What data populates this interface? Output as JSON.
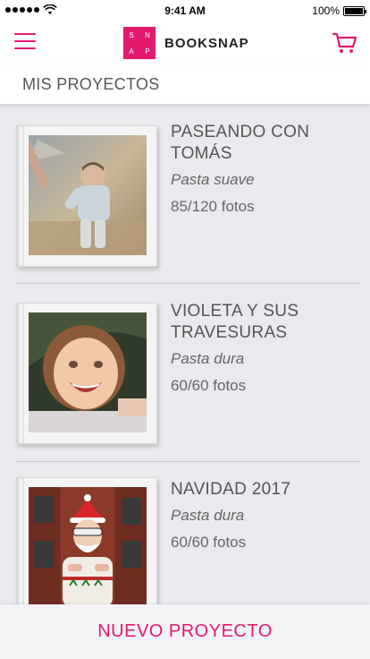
{
  "status_bar": {
    "carrier_signal": "signal-dots-icon",
    "time": "9:41 AM",
    "battery": "100%"
  },
  "header": {
    "logo_letters": [
      "S",
      "N",
      "A",
      "P"
    ],
    "brand": "BOOKSNAP"
  },
  "section": {
    "title": "MIS PROYECTOS"
  },
  "projects": [
    {
      "title_line1": "PASEANDO CON",
      "title_line2": "TOMÁS",
      "cover": "Pasta suave",
      "photos": "85/120 fotos"
    },
    {
      "title_line1": "VIOLETA Y SUS",
      "title_line2": "TRAVESURAS",
      "cover": "Pasta dura",
      "photos": "60/60 fotos"
    },
    {
      "title_line1": "NAVIDAD 2017",
      "title_line2": "",
      "cover": "Pasta dura",
      "photos": "60/60 fotos"
    }
  ],
  "footer": {
    "new_project_label": "NUEVO PROYECTO"
  },
  "colors": {
    "accent": "#e5196d",
    "background": "#e9e9ee"
  }
}
